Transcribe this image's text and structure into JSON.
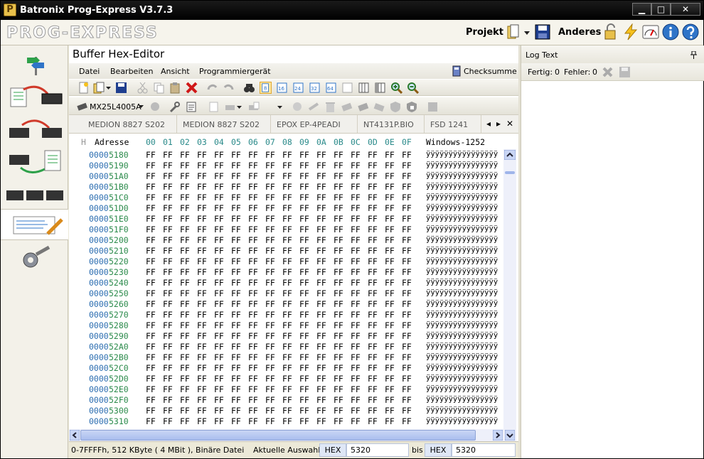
{
  "window": {
    "title": "Batronix Prog-Express V3.7.3",
    "controls": {
      "minimize": "▁",
      "maximize": "□",
      "close": "✕"
    }
  },
  "brandbar": {
    "logo": "PROG-EXPRESS",
    "projekt_label": "Projekt",
    "anderes_label": "Anderes"
  },
  "editor": {
    "header": "Buffer Hex-Editor",
    "menus": [
      "Datei",
      "Bearbeiten",
      "Ansicht",
      "Programmiergerät"
    ],
    "checksum_label": "Checksumme",
    "chip": "MX25L4005A",
    "tabs": [
      "MEDION 8827 S202",
      "MEDION 8827 S202",
      "EPOX EP-4PEADI",
      "NT4131P.BIO",
      "FSD 1241"
    ],
    "tab_controls": {
      "prev": "◂",
      "next": "▸",
      "close": "✕"
    },
    "col_marker": "H",
    "address_header": "Adresse",
    "col_headers": [
      "00",
      "01",
      "02",
      "03",
      "04",
      "05",
      "06",
      "07",
      "08",
      "09",
      "0A",
      "0B",
      "0C",
      "0D",
      "0E",
      "0F"
    ],
    "encoding_header": "Windows-1252",
    "rows": [
      {
        "addr_prefix": "0000",
        "addr_suffix": "5180",
        "bytes": "FF",
        "text": "ÿÿÿÿÿÿÿÿÿÿÿÿÿÿÿÿ"
      },
      {
        "addr_prefix": "0000",
        "addr_suffix": "5190",
        "bytes": "FF",
        "text": "ÿÿÿÿÿÿÿÿÿÿÿÿÿÿÿÿ"
      },
      {
        "addr_prefix": "0000",
        "addr_suffix": "51A0",
        "bytes": "FF",
        "text": "ÿÿÿÿÿÿÿÿÿÿÿÿÿÿÿÿ"
      },
      {
        "addr_prefix": "0000",
        "addr_suffix": "51B0",
        "bytes": "FF",
        "text": "ÿÿÿÿÿÿÿÿÿÿÿÿÿÿÿÿ"
      },
      {
        "addr_prefix": "0000",
        "addr_suffix": "51C0",
        "bytes": "FF",
        "text": "ÿÿÿÿÿÿÿÿÿÿÿÿÿÿÿÿ"
      },
      {
        "addr_prefix": "0000",
        "addr_suffix": "51D0",
        "bytes": "FF",
        "text": "ÿÿÿÿÿÿÿÿÿÿÿÿÿÿÿÿ"
      },
      {
        "addr_prefix": "0000",
        "addr_suffix": "51E0",
        "bytes": "FF",
        "text": "ÿÿÿÿÿÿÿÿÿÿÿÿÿÿÿÿ"
      },
      {
        "addr_prefix": "0000",
        "addr_suffix": "51F0",
        "bytes": "FF",
        "text": "ÿÿÿÿÿÿÿÿÿÿÿÿÿÿÿÿ"
      },
      {
        "addr_prefix": "0000",
        "addr_suffix": "5200",
        "bytes": "FF",
        "text": "ÿÿÿÿÿÿÿÿÿÿÿÿÿÿÿÿ"
      },
      {
        "addr_prefix": "0000",
        "addr_suffix": "5210",
        "bytes": "FF",
        "text": "ÿÿÿÿÿÿÿÿÿÿÿÿÿÿÿÿ"
      },
      {
        "addr_prefix": "0000",
        "addr_suffix": "5220",
        "bytes": "FF",
        "text": "ÿÿÿÿÿÿÿÿÿÿÿÿÿÿÿÿ"
      },
      {
        "addr_prefix": "0000",
        "addr_suffix": "5230",
        "bytes": "FF",
        "text": "ÿÿÿÿÿÿÿÿÿÿÿÿÿÿÿÿ"
      },
      {
        "addr_prefix": "0000",
        "addr_suffix": "5240",
        "bytes": "FF",
        "text": "ÿÿÿÿÿÿÿÿÿÿÿÿÿÿÿÿ"
      },
      {
        "addr_prefix": "0000",
        "addr_suffix": "5250",
        "bytes": "FF",
        "text": "ÿÿÿÿÿÿÿÿÿÿÿÿÿÿÿÿ"
      },
      {
        "addr_prefix": "0000",
        "addr_suffix": "5260",
        "bytes": "FF",
        "text": "ÿÿÿÿÿÿÿÿÿÿÿÿÿÿÿÿ"
      },
      {
        "addr_prefix": "0000",
        "addr_suffix": "5270",
        "bytes": "FF",
        "text": "ÿÿÿÿÿÿÿÿÿÿÿÿÿÿÿÿ"
      },
      {
        "addr_prefix": "0000",
        "addr_suffix": "5280",
        "bytes": "FF",
        "text": "ÿÿÿÿÿÿÿÿÿÿÿÿÿÿÿÿ"
      },
      {
        "addr_prefix": "0000",
        "addr_suffix": "5290",
        "bytes": "FF",
        "text": "ÿÿÿÿÿÿÿÿÿÿÿÿÿÿÿÿ"
      },
      {
        "addr_prefix": "0000",
        "addr_suffix": "52A0",
        "bytes": "FF",
        "text": "ÿÿÿÿÿÿÿÿÿÿÿÿÿÿÿÿ"
      },
      {
        "addr_prefix": "0000",
        "addr_suffix": "52B0",
        "bytes": "FF",
        "text": "ÿÿÿÿÿÿÿÿÿÿÿÿÿÿÿÿ"
      },
      {
        "addr_prefix": "0000",
        "addr_suffix": "52C0",
        "bytes": "FF",
        "text": "ÿÿÿÿÿÿÿÿÿÿÿÿÿÿÿÿ"
      },
      {
        "addr_prefix": "0000",
        "addr_suffix": "52D0",
        "bytes": "FF",
        "text": "ÿÿÿÿÿÿÿÿÿÿÿÿÿÿÿÿ"
      },
      {
        "addr_prefix": "0000",
        "addr_suffix": "52E0",
        "bytes": "FF",
        "text": "ÿÿÿÿÿÿÿÿÿÿÿÿÿÿÿÿ"
      },
      {
        "addr_prefix": "0000",
        "addr_suffix": "52F0",
        "bytes": "FF",
        "text": "ÿÿÿÿÿÿÿÿÿÿÿÿÿÿÿÿ"
      },
      {
        "addr_prefix": "0000",
        "addr_suffix": "5300",
        "bytes": "FF",
        "text": "ÿÿÿÿÿÿÿÿÿÿÿÿÿÿÿÿ"
      },
      {
        "addr_prefix": "0000",
        "addr_suffix": "5310",
        "bytes": "FF",
        "text": "ÿÿÿÿÿÿÿÿÿÿÿÿÿÿÿÿ"
      }
    ],
    "status": {
      "info": "0-7FFFFh, 512 KByte ( 4 MBit ), Binäre Datei",
      "selection_label": "Aktuelle Auswahl:",
      "from_format": "HEX",
      "from_value": "5320",
      "bis_label": "bis",
      "to_format": "HEX",
      "to_value": "5320"
    }
  },
  "log": {
    "header": "Log Text",
    "pin_icon": "📌",
    "fertig_label": "Fertig:",
    "fertig_value": "0",
    "fehler_label": "Fehler:",
    "fehler_value": "0"
  },
  "colors": {
    "address_prefix": "#2b6db0",
    "address_suffix": "#2a8a4a",
    "header_hex": "#2a8a8a",
    "titlebar": "#000000"
  },
  "icons": {
    "sidebar": [
      "signpost-icon",
      "file-to-chip-icon",
      "chip-to-chip-icon",
      "chip-to-file-icon",
      "multi-chip-icon",
      "hex-editor-icon",
      "settings-tools-icon"
    ]
  }
}
